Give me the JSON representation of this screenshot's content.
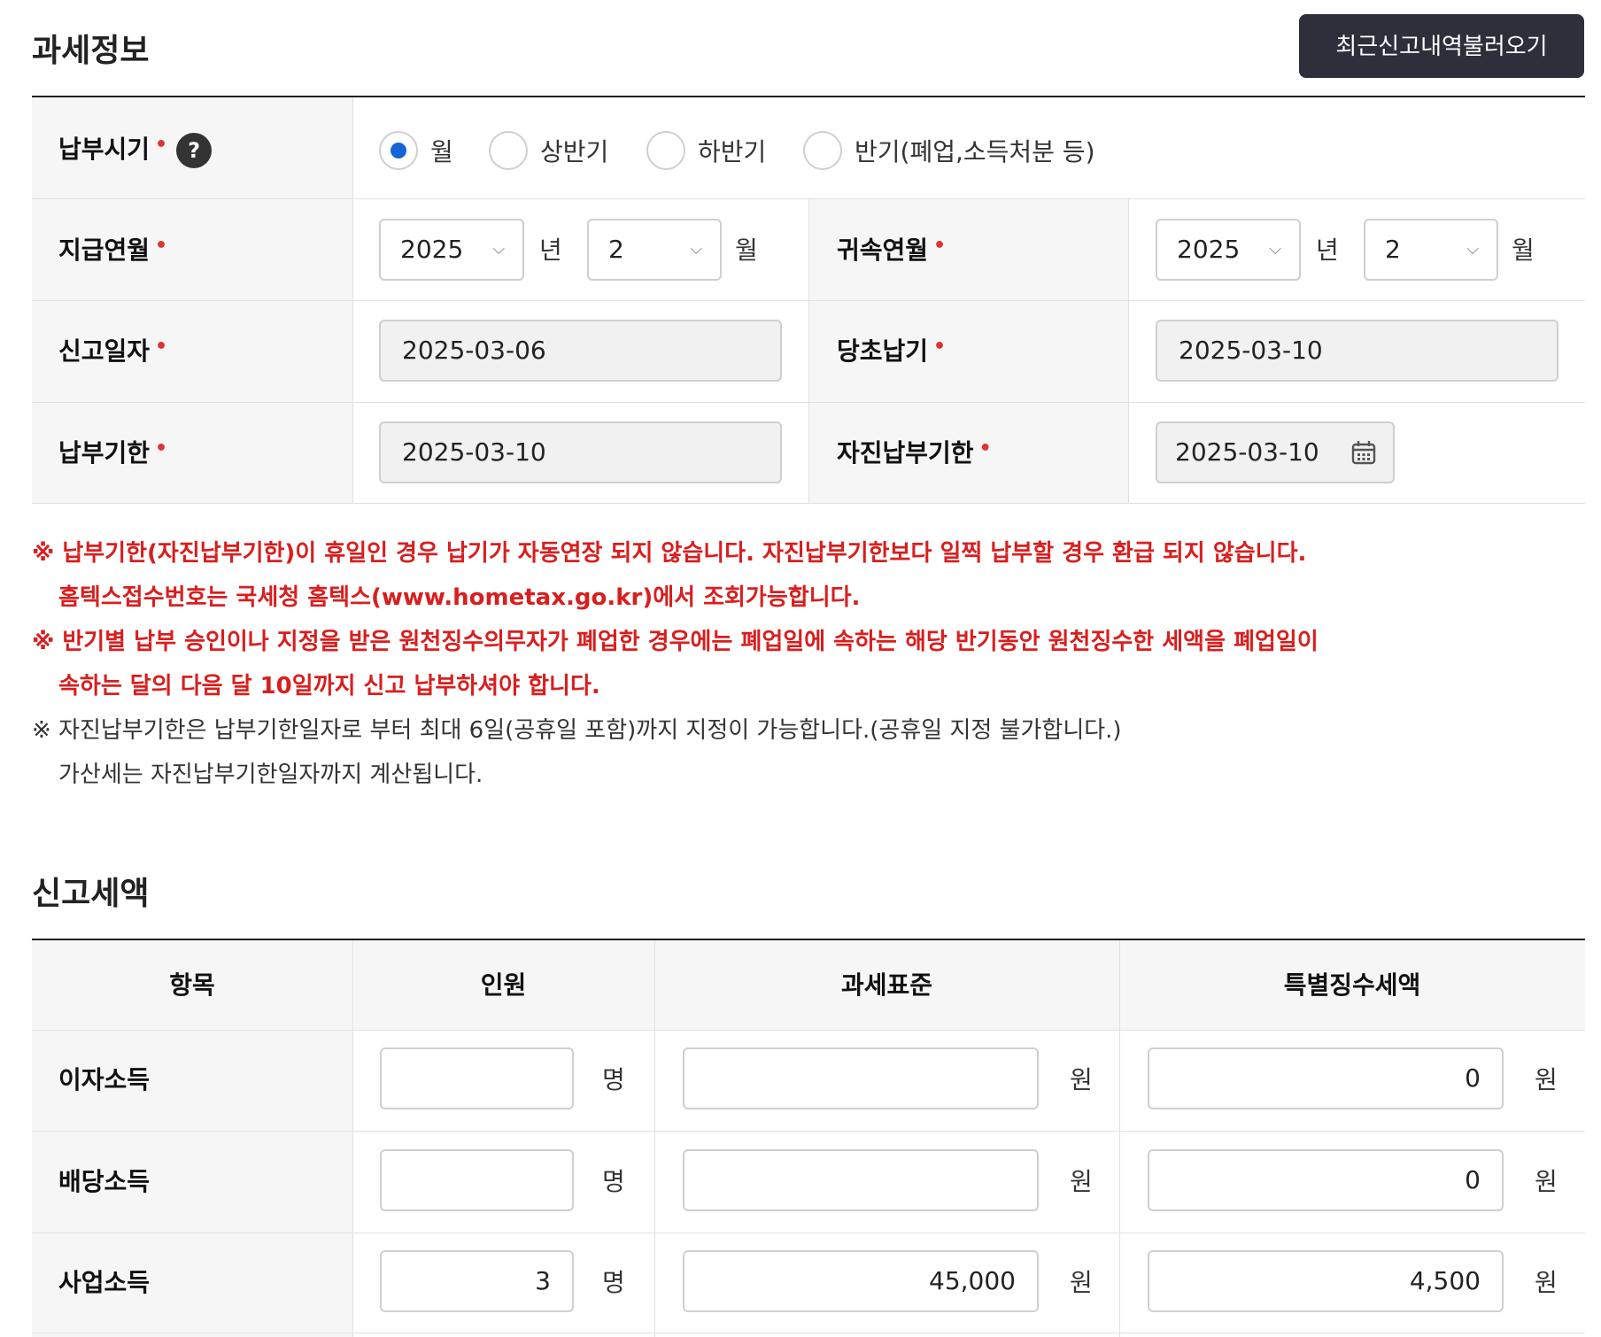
{
  "tax_info": {
    "title": "과세정보",
    "load_recent_button": "최근신고내역불러오기",
    "payment_period": {
      "label": "납부시기",
      "help_glyph": "?",
      "options": [
        "월",
        "상반기",
        "하반기",
        "반기(폐업,소득처분 등)"
      ],
      "selected": "월"
    },
    "pay_month": {
      "label": "지급연월",
      "year": "2025",
      "month": "2",
      "year_unit": "년",
      "month_unit": "월"
    },
    "belong_month": {
      "label": "귀속연월",
      "year": "2025",
      "month": "2",
      "year_unit": "년",
      "month_unit": "월"
    },
    "report_date": {
      "label": "신고일자",
      "value": "2025-03-06"
    },
    "original_due": {
      "label": "당초납기",
      "value": "2025-03-10"
    },
    "due_date": {
      "label": "납부기한",
      "value": "2025-03-10"
    },
    "self_due_date": {
      "label": "자진납부기한",
      "value": "2025-03-10"
    },
    "required_mark": "•"
  },
  "notes": [
    {
      "mark": "※",
      "line1": "납부기한(자진납부기한)이 휴일인 경우 납기가 자동연장 되지 않습니다. 자진납부기한보다 일찍 납부할 경우 환급 되지 않습니다.",
      "line2": "홈텍스접수번호는 국세청 홈텍스(www.hometax.go.kr)에서 조회가능합니다."
    },
    {
      "mark": "※",
      "line1": "반기별 납부 승인이나 지정을 받은 원천징수의무자가 폐업한 경우에는 폐업일에 속하는 해당 반기동안 원천징수한 세액을 폐업일이",
      "line2": "속하는 달의 다음 달 10일까지 신고 납부하셔야 합니다."
    },
    {
      "mark": "※",
      "line1": "자진납부기한은 납부기한일자로 부터 최대 6일(공휴일 포함)까지 지정이 가능합니다.(공휴일 지정 불가합니다.)",
      "line2": "가산세는 자진납부기한일자까지 계산됩니다."
    }
  ],
  "tax_amount": {
    "title": "신고세액",
    "headers": [
      "항목",
      "인원",
      "과세표준",
      "특별징수세액"
    ],
    "person_unit": "명",
    "won_unit": "원",
    "rows": [
      {
        "item": "이자소득",
        "persons": "",
        "tax_base": "",
        "tax": "0"
      },
      {
        "item": "배당소득",
        "persons": "",
        "tax_base": "",
        "tax": "0"
      },
      {
        "item": "사업소득",
        "persons": "3",
        "tax_base": "45,000",
        "tax": "4,500"
      }
    ]
  },
  "colors": {
    "required": "#e0322e",
    "warning": "#d91e1e",
    "radio_selected": "#1665d8",
    "button_bg": "#2d2f3a"
  }
}
